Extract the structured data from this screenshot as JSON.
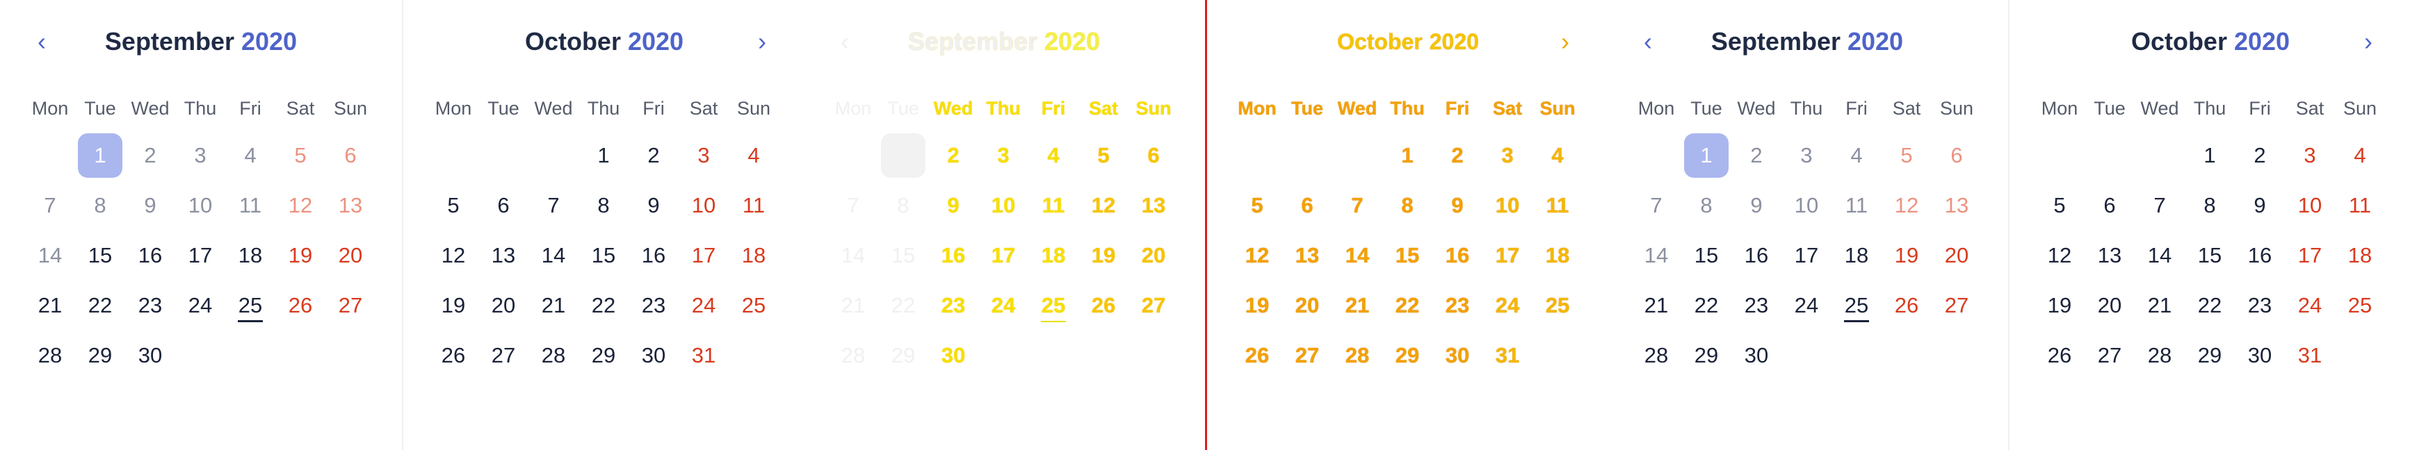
{
  "calendars": [
    {
      "id": "panel-1",
      "left_month": {
        "month_label": "September",
        "year_label": "2020",
        "prev_label": "‹",
        "weekdays": [
          "Mon",
          "Tue",
          "Wed",
          "Thu",
          "Fri",
          "Sat",
          "Sun"
        ],
        "days": [
          "1",
          "2",
          "3",
          "4",
          "5",
          "6",
          "7",
          "8",
          "9",
          "10",
          "11",
          "12",
          "13",
          "14",
          "15",
          "16",
          "17",
          "18",
          "19",
          "20",
          "21",
          "22",
          "23",
          "24",
          "25",
          "26",
          "27",
          "28",
          "29",
          "30"
        ]
      },
      "right_month": {
        "month_label": "October",
        "year_label": "2020",
        "next_label": "›",
        "weekdays": [
          "Mon",
          "Tue",
          "Wed",
          "Thu",
          "Fri",
          "Sat",
          "Sun"
        ],
        "days": [
          "1",
          "2",
          "3",
          "4",
          "5",
          "6",
          "7",
          "8",
          "9",
          "10",
          "11",
          "12",
          "13",
          "14",
          "15",
          "16",
          "17",
          "18",
          "19",
          "20",
          "21",
          "22",
          "23",
          "24",
          "25",
          "26",
          "27",
          "28",
          "29",
          "30",
          "31"
        ]
      }
    },
    {
      "id": "panel-2",
      "left_month": {
        "month_label": "September",
        "year_label": "2020",
        "prev_label": "‹",
        "weekdays": [
          "Mon",
          "Tue",
          "Wed",
          "Thu",
          "Fri",
          "Sat",
          "Sun"
        ],
        "days": [
          "1",
          "2",
          "3",
          "4",
          "5",
          "6",
          "7",
          "8",
          "9",
          "10",
          "11",
          "12",
          "13",
          "14",
          "15",
          "16",
          "17",
          "18",
          "19",
          "20",
          "21",
          "22",
          "23",
          "24",
          "25",
          "26",
          "27",
          "28",
          "29",
          "30"
        ]
      },
      "right_month": {
        "month_label": "October",
        "year_label": "2020",
        "next_label": "›",
        "weekdays": [
          "Mon",
          "Tue",
          "Wed",
          "Thu",
          "Fri",
          "Sat",
          "Sun"
        ],
        "days": [
          "1",
          "2",
          "3",
          "4",
          "5",
          "6",
          "7",
          "8",
          "9",
          "10",
          "11",
          "12",
          "13",
          "14",
          "15",
          "16",
          "17",
          "18",
          "19",
          "20",
          "21",
          "22",
          "23",
          "24",
          "25",
          "26",
          "27",
          "28",
          "29",
          "30",
          "31"
        ]
      }
    },
    {
      "id": "panel-3",
      "left_month": {
        "month_label": "September",
        "year_label": "2020",
        "prev_label": "‹",
        "weekdays": [
          "Mon",
          "Tue",
          "Wed",
          "Thu",
          "Fri",
          "Sat",
          "Sun"
        ],
        "days": [
          "1",
          "2",
          "3",
          "4",
          "5",
          "6",
          "7",
          "8",
          "9",
          "10",
          "11",
          "12",
          "13",
          "14",
          "15",
          "16",
          "17",
          "18",
          "19",
          "20",
          "21",
          "22",
          "23",
          "24",
          "25",
          "26",
          "27",
          "28",
          "29",
          "30"
        ]
      },
      "right_month": {
        "month_label": "October",
        "year_label": "2020",
        "next_label": "›",
        "weekdays": [
          "Mon",
          "Tue",
          "Wed",
          "Thu",
          "Fri",
          "Sat",
          "Sun"
        ],
        "days": [
          "1",
          "2",
          "3",
          "4",
          "5",
          "6",
          "7",
          "8",
          "9",
          "10",
          "11",
          "12",
          "13",
          "14",
          "15",
          "16",
          "17",
          "18",
          "19",
          "20",
          "21",
          "22",
          "23",
          "24",
          "25",
          "26",
          "27",
          "28",
          "29",
          "30",
          "31"
        ]
      }
    }
  ],
  "selected_day": "1",
  "today_day": "25",
  "colors": {
    "accent": "#4e63c9",
    "selected_bg": "#aab6ee",
    "weekend": "#d93a1e",
    "text": "#1a2238"
  },
  "icons": {
    "prev": "chevron-left-icon",
    "next": "chevron-right-icon"
  }
}
